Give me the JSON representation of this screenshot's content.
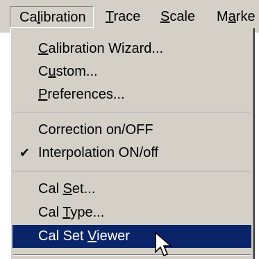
{
  "menubar": {
    "items": [
      {
        "pre": "Ca",
        "key": "l",
        "post": "ibration"
      },
      {
        "pre": "",
        "key": "T",
        "post": "race"
      },
      {
        "pre": "",
        "key": "S",
        "post": "cale"
      },
      {
        "pre": "M",
        "key": "a",
        "post": "rke"
      }
    ]
  },
  "menu": {
    "group1": [
      {
        "pre": "",
        "key": "C",
        "post": "alibration Wizard..."
      },
      {
        "pre": "C",
        "key": "u",
        "post": "stom..."
      },
      {
        "pre": "",
        "key": "P",
        "post": "references..."
      }
    ],
    "group2": [
      {
        "text": "Correction on/OFF"
      },
      {
        "text": "Interpolation ON/off",
        "check": "✔"
      }
    ],
    "group3": [
      {
        "pre": "Cal ",
        "key": "S",
        "post": "et..."
      },
      {
        "pre": "Cal ",
        "key": "T",
        "post": "ype..."
      },
      {
        "pre": "Cal Set ",
        "key": "V",
        "post": "iewer"
      }
    ]
  },
  "colors": {
    "menu_bg": "#d4d0c8",
    "selection_bg": "#0a246a",
    "selection_fg": "#ffffff"
  },
  "icons": {
    "check": "checkmark-icon",
    "cursor": "mouse-pointer-icon"
  }
}
